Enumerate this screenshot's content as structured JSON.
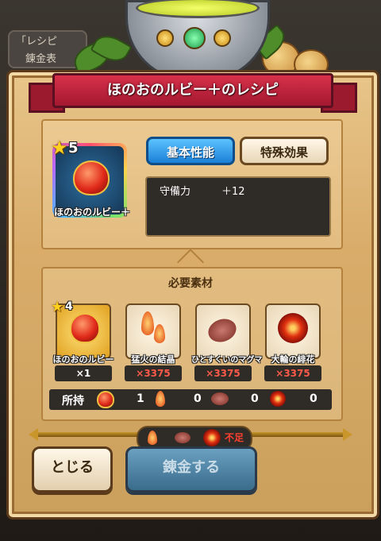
{
  "background": {
    "tab_text_line1": "「レシピ",
    "tab_text_line2": "錬金表"
  },
  "banner": {
    "title": "ほのおのルビー＋のレシピ"
  },
  "target_item": {
    "stars": "5",
    "name": "ほのおのルビー＋"
  },
  "tabs": {
    "basic": "基本性能",
    "special": "特殊効果"
  },
  "stats": [
    {
      "label": "守備力",
      "value": "＋12"
    }
  ],
  "materials": {
    "title": "必要素材",
    "items": [
      {
        "name": "ほのおのルビー",
        "stars": "4",
        "qty": "×1",
        "qty_color": "white"
      },
      {
        "name": "猛火の結晶",
        "qty": "×3375",
        "qty_color": "red"
      },
      {
        "name": "ひとすくいのマグマ",
        "qty": "×3375",
        "qty_color": "red"
      },
      {
        "name": "大輪の緋花",
        "qty": "×3375",
        "qty_color": "red"
      }
    ],
    "owned_label": "所持",
    "owned_counts": [
      "1",
      "0",
      "0",
      "0"
    ]
  },
  "footer": {
    "shortage": "不足",
    "close": "とじる",
    "alchemy": "錬金する"
  },
  "colors": {
    "banner": "#c0253d",
    "tab_active": "#1b7fd6",
    "shortage_text": "#ff4030",
    "alchemy_disabled": "#3a6c8c"
  }
}
